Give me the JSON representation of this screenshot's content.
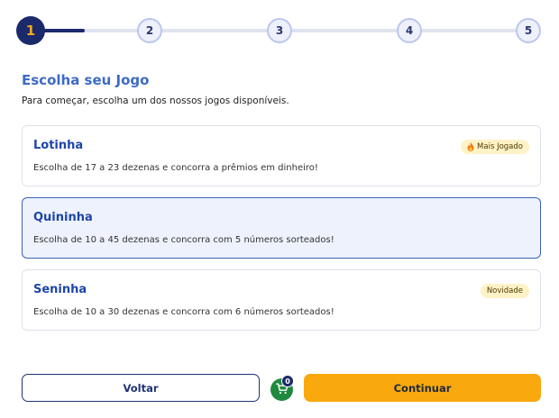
{
  "stepper": {
    "current": 1,
    "steps": [
      "1",
      "2",
      "3",
      "4",
      "5"
    ]
  },
  "header": {
    "title": "Escolha seu Jogo",
    "subtitle": "Para começar, escolha um dos nossos jogos disponíveis."
  },
  "games": [
    {
      "name": "Lotinha",
      "description": "Escolha de 17 a 23 dezenas e concorra a prêmios em dinheiro!",
      "badge": "Mais Jogado",
      "badge_icon": "flame-icon",
      "selected": false
    },
    {
      "name": "Quininha",
      "description": "Escolha de 10 a 45 dezenas e concorra com 5 números sorteados!",
      "badge": "",
      "selected": true
    },
    {
      "name": "Seninha",
      "description": "Escolha de 10 a 30 dezenas e concorra com 6 números sorteados!",
      "badge": "Novidade",
      "selected": false
    }
  ],
  "footer": {
    "back_label": "Voltar",
    "cart_count": "0",
    "cart_icon": "cart-icon",
    "continue_label": "Continuar"
  },
  "colors": {
    "primary": "#1b2a6b",
    "accent": "#f9a80e",
    "link": "#1e46a8",
    "selected_bg": "#edf2fd",
    "cart": "#1f8a3d"
  }
}
